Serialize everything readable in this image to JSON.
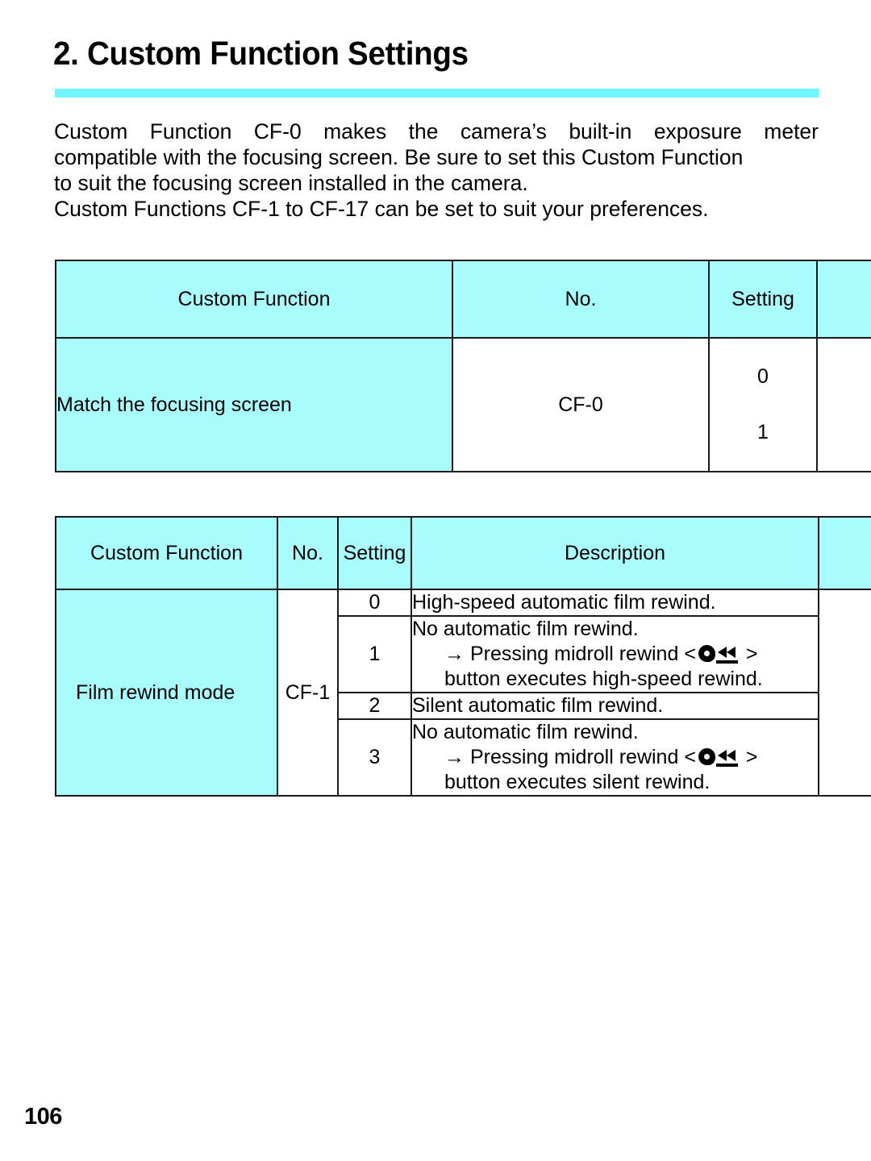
{
  "page": {
    "title": "2. Custom Function Settings",
    "number": "106",
    "accent_color": "#6ff6ff",
    "cell_fill_color": "#a9fcfc"
  },
  "intro": {
    "line1": "Custom Function CF-0 makes the camera’s built-in exposure meter",
    "line1_words": [
      "Custom",
      "Function",
      "CF-0",
      "makes",
      "the",
      "camera’s",
      "built-in",
      "exposure",
      "meter"
    ],
    "line2": "compatible with the focusing screen. Be sure to set this Custom Function",
    "line3": "to suit the focusing screen installed in the camera.",
    "line4": "Custom Functions CF-1 to CF-17 can be set to suit your preferences."
  },
  "table_one": {
    "headers": {
      "function": "Custom Function",
      "no": "No.",
      "setting": "Setting",
      "description": ""
    },
    "rows": [
      {
        "function": "Match the focusing screen",
        "no": "CF-0",
        "settings": [
          "0",
          "1"
        ],
        "description": ""
      }
    ]
  },
  "table_two": {
    "headers": {
      "function": "Custom Function",
      "no": "No.",
      "setting": "Setting",
      "description": "Description",
      "extra": ""
    },
    "rows": [
      {
        "function": "Film rewind mode",
        "no": "CF-1",
        "settings": [
          {
            "value": "0",
            "description": "High-speed automatic film rewind.",
            "sub_lines": []
          },
          {
            "value": "1",
            "description": "No automatic film rewind.",
            "sub_lines": [
              {
                "prefix": "→ Pressing midroll rewind <",
                "icon": "midroll-rewind-icon",
                "suffix": ">"
              },
              {
                "text": "button executes high-speed rewind."
              }
            ]
          },
          {
            "value": "2",
            "description": "Silent automatic film rewind.",
            "sub_lines": []
          },
          {
            "value": "3",
            "description": "No automatic film rewind.",
            "sub_lines": [
              {
                "prefix": "→ Pressing midroll rewind <",
                "icon": "midroll-rewind-icon",
                "suffix": ">"
              },
              {
                "text": "button executes silent rewind."
              }
            ]
          }
        ]
      }
    ]
  }
}
